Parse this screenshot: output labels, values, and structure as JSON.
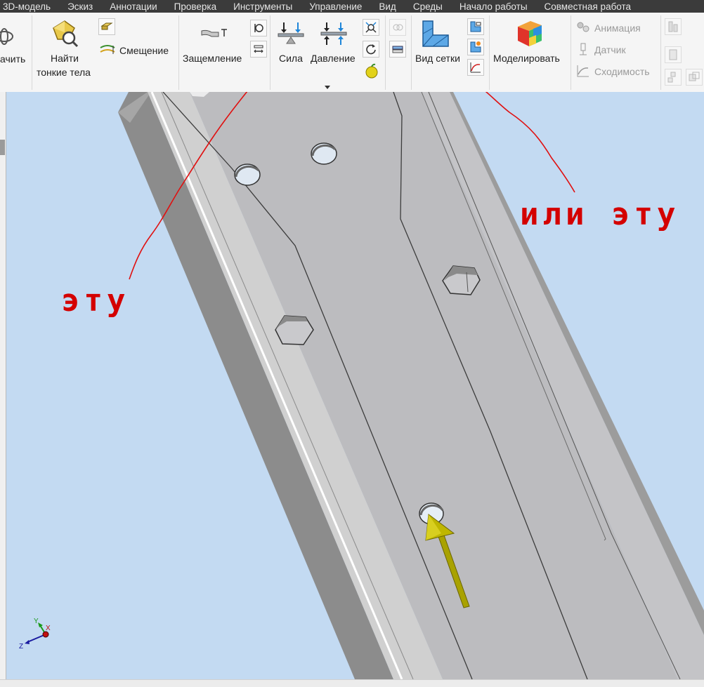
{
  "menu": [
    "3D-модель",
    "Эскиз",
    "Аннотации",
    "Проверка",
    "Инструменты",
    "Управление",
    "Вид",
    "Среды",
    "Начало работы",
    "Совместная работа"
  ],
  "ribbon": {
    "start_partial": "ачить",
    "find_thin_line1": "Найти",
    "find_thin_line2": "тонкие тела",
    "offset": "Смещение",
    "clamp": "Защемление",
    "force": "Сила",
    "pressure": "Давление",
    "mesh_view": "Вид сетки",
    "simulate": "Моделировать",
    "animation": "Анимация",
    "sensor": "Датчик",
    "convergence": "Сходимость"
  },
  "annotations": {
    "this_one": "эту",
    "or_this_one": "или эту"
  },
  "triad": {
    "x": "X",
    "y": "Y",
    "z": "Z"
  },
  "colors": {
    "annotation_red": "#d40000",
    "viewport_bg": "#c3daf2",
    "menu_bg": "#3b3b3b",
    "load_arrow": "#b8b000"
  }
}
